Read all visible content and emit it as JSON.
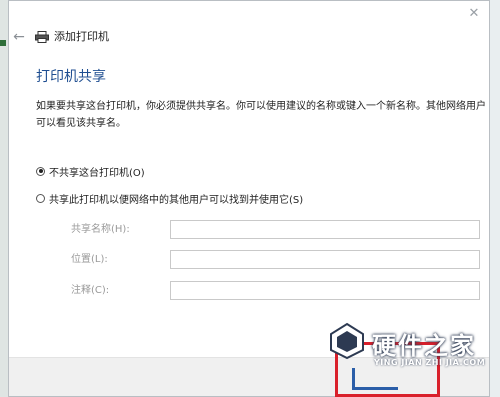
{
  "dialog": {
    "header_title": "添加打印机",
    "section_heading": "打印机共享",
    "description": "如果要共享这台打印机，你必须提供共享名。你可以使用建议的名称或键入一个新名称。其他网络用户可以看见该共享名。",
    "options": [
      {
        "label": "不共享这台打印机(O)",
        "checked": true
      },
      {
        "label": "共享此打印机以便网络中的其他用户可以找到并使用它(S)",
        "checked": false
      }
    ],
    "fields": [
      {
        "label": "共享名称(H):",
        "value": ""
      },
      {
        "label": "位置(L):",
        "value": ""
      },
      {
        "label": "注释(C):",
        "value": ""
      }
    ]
  },
  "watermark": {
    "name": "硬件之家",
    "url": "YING JIAN ZHI JIA.COM"
  },
  "colors": {
    "heading": "#1f4e91",
    "highlight_frame": "#d9202b"
  },
  "icons": [
    "close-icon",
    "back-arrow-icon",
    "printer-icon",
    "watermark-logo-icon"
  ]
}
